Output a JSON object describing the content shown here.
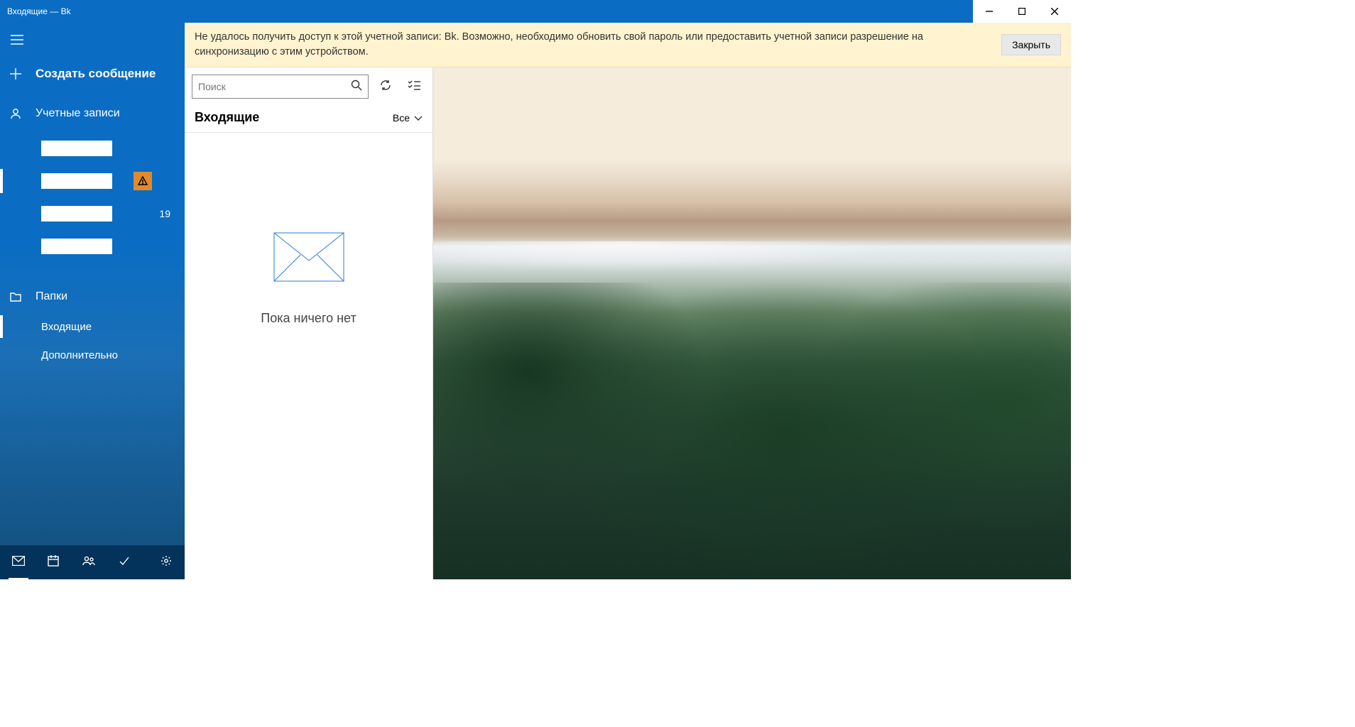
{
  "window": {
    "title": "Входящие — Bk"
  },
  "banner": {
    "message": "Не удалось получить доступ к этой учетной записи: Bk. Возможно, необходимо обновить свой пароль или предоставить учетной записи разрешение на синхронизацию с этим устройством.",
    "close_label": "Закрыть"
  },
  "sidebar": {
    "compose_label": "Создать сообщение",
    "accounts_header": "Учетные записи",
    "accounts": [
      {
        "redacted": true
      },
      {
        "redacted": true,
        "selected": true,
        "warning": true
      },
      {
        "redacted": true,
        "count": "19"
      },
      {
        "redacted": true
      }
    ],
    "folders_header": "Папки",
    "folders": [
      {
        "label": "Входящие",
        "selected": true
      },
      {
        "label": "Дополнительно",
        "selected": false
      }
    ]
  },
  "list": {
    "search_placeholder": "Поиск",
    "title": "Входящие",
    "filter_label": "Все",
    "empty_text": "Пока ничего нет"
  }
}
